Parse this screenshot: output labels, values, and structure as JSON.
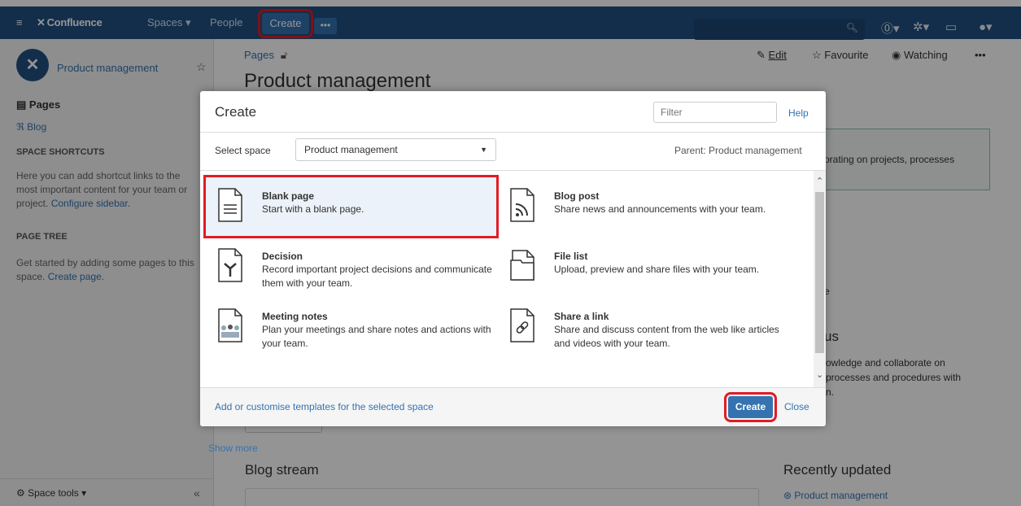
{
  "header": {
    "app_name": "Confluence",
    "nav_spaces": "Spaces ▾",
    "nav_people": "People",
    "create_label": "Create",
    "more_label": "•••"
  },
  "sidebar": {
    "space_name": "Product management",
    "pages_label": "Pages",
    "blog_label": "Blog",
    "shortcuts_heading": "SPACE SHORTCUTS",
    "shortcuts_text": "Here you can add shortcut links to the most important content for your team or project.",
    "configure_link": "Configure sidebar.",
    "page_tree_heading": "PAGE TREE",
    "page_tree_text": "Get started by adding some pages to this space.",
    "create_page_link": "Create page.",
    "space_tools": "Space tools ▾"
  },
  "page": {
    "breadcrumb": "Pages",
    "title": "Product management",
    "edit_label": "Edit",
    "favourite_label": "Favourite",
    "watching_label": "Watching",
    "panel_text": "orating on projects, processes",
    "bg_e": "e",
    "bg_us": "us",
    "bg_text1": "owledge and collaborate on",
    "bg_text2": "processes and procedures with",
    "bg_text3": "n.",
    "blog_stream": "Blog stream",
    "recently_updated": "Recently updated",
    "recent_item": "Product management"
  },
  "dialog": {
    "title": "Create",
    "filter_placeholder": "Filter",
    "help": "Help",
    "select_label": "Select space",
    "select_value": "Product management",
    "parent": "Parent: Product management",
    "blueprints": [
      {
        "name": "Blank page",
        "desc": "Start with a blank page.",
        "icon": "document-icon"
      },
      {
        "name": "Blog post",
        "desc": "Share news and announcements with your team.",
        "icon": "rss-icon"
      },
      {
        "name": "Decision",
        "desc": "Record important project decisions and communicate them with your team.",
        "icon": "decision-icon"
      },
      {
        "name": "File list",
        "desc": "Upload, preview and share files with your team.",
        "icon": "folder-icon"
      },
      {
        "name": "Meeting notes",
        "desc": "Plan your meetings and share notes and actions with your team.",
        "icon": "meeting-icon"
      },
      {
        "name": "Share a link",
        "desc": "Share and discuss content from the web like articles and videos with your team.",
        "icon": "link-icon"
      }
    ],
    "show_more": "Show more",
    "customise": "Add or customise templates for the selected space",
    "create_button": "Create",
    "close_button": "Close"
  }
}
